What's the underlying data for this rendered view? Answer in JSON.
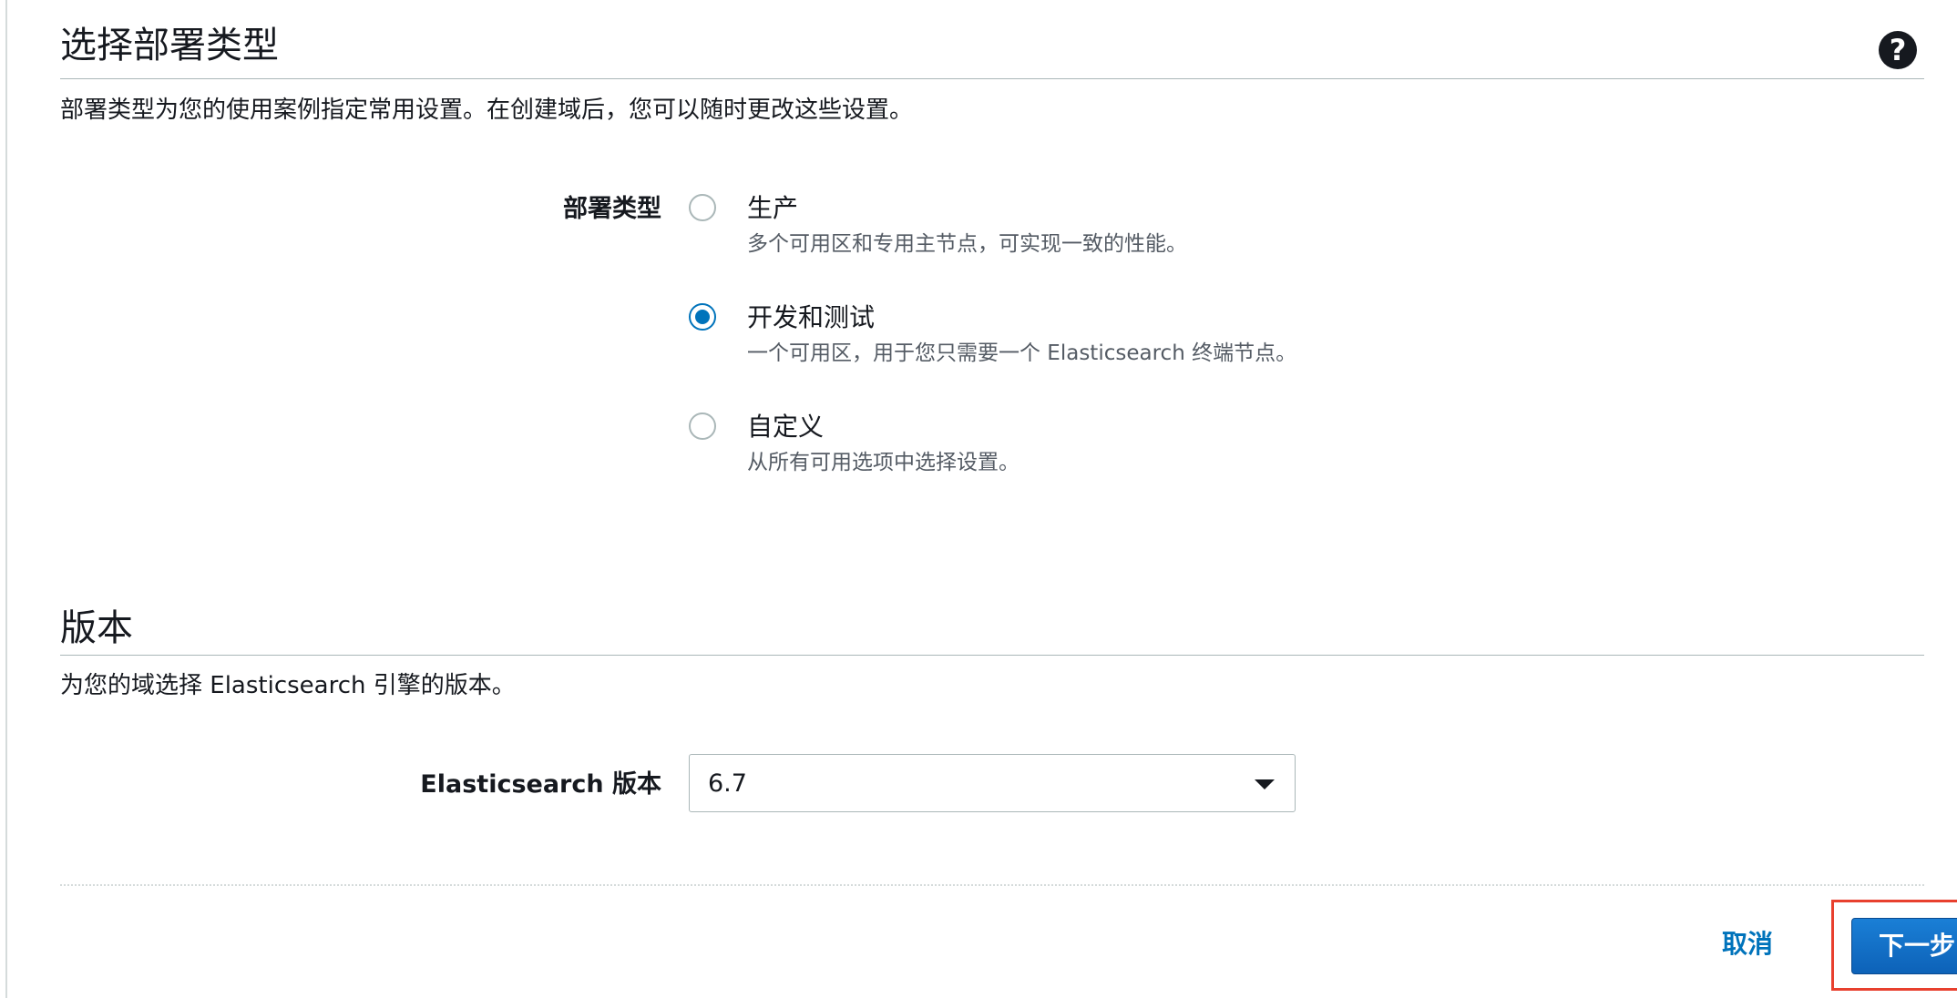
{
  "deployment_section": {
    "title": "选择部署类型",
    "description": "部署类型为您的使用案例指定常用设置。在创建域后，您可以随时更改这些设置。",
    "help_icon": "question-circle-icon",
    "field_label": "部署类型",
    "options": [
      {
        "title": "生产",
        "description": "多个可用区和专用主节点，可实现一致的性能。",
        "checked": false
      },
      {
        "title": "开发和测试",
        "description": "一个可用区，用于您只需要一个 Elasticsearch 终端节点。",
        "checked": true
      },
      {
        "title": "自定义",
        "description": "从所有可用选项中选择设置。",
        "checked": false
      }
    ]
  },
  "version_section": {
    "title": "版本",
    "description": "为您的域选择 Elasticsearch 引擎的版本。",
    "field_label": "Elasticsearch 版本",
    "selected_version": "6.7"
  },
  "footer": {
    "cancel_label": "取消",
    "next_label": "下一步"
  },
  "colors": {
    "accent": "#0073bb",
    "highlight_box": "#e8402e"
  }
}
